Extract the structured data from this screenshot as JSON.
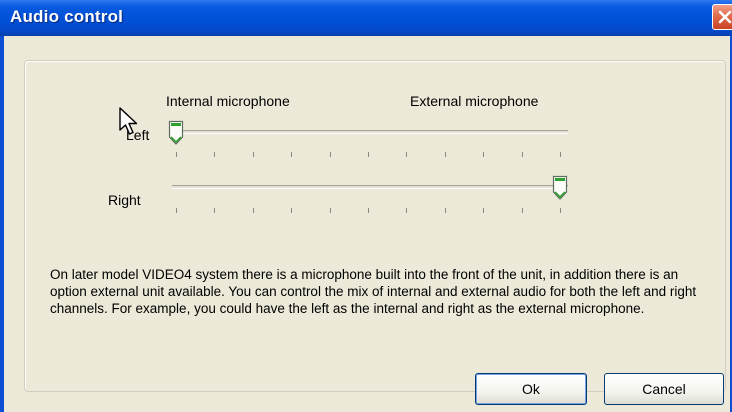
{
  "window": {
    "title": "Audio control"
  },
  "mixer": {
    "internal_label": "Internal microphone",
    "external_label": "External microphone",
    "channels": [
      {
        "label": "Left",
        "value_percent": 0
      },
      {
        "label": "Right",
        "value_percent": 100
      }
    ],
    "tick_count": 11
  },
  "description": "On later model VIDEO4 system there is a microphone built into the front of the unit, in addition there is an option external unit available. You can control the mix of internal and external audio for both the left and right channels. For example, you could have the left as the internal and right as the external microphone.",
  "buttons": {
    "ok": "Ok",
    "cancel": "Cancel"
  },
  "colors": {
    "title_bar": "#0051d8",
    "dialog_background": "#ece9d8",
    "close_button": "#e06a4a",
    "thumb_accent": "#2fa02f"
  },
  "icons": {
    "close": "close-icon",
    "cursor": "mouse-pointer-icon"
  }
}
